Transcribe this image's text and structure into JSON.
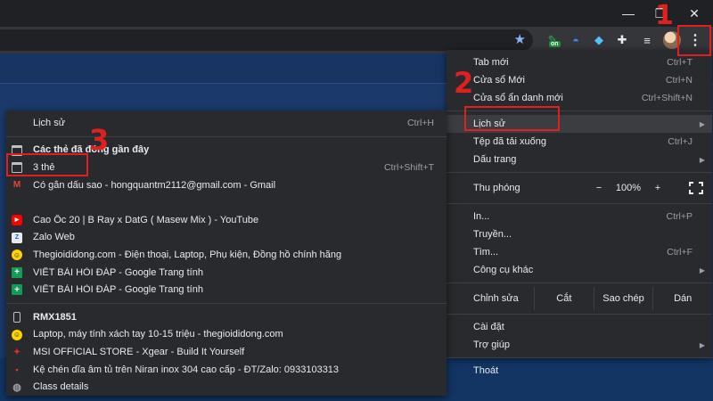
{
  "titlebar": {
    "controls": [
      {
        "name": "minimize-button",
        "glyph": "—"
      },
      {
        "name": "maximize-button",
        "glyph": "❐"
      },
      {
        "name": "close-button",
        "glyph": "✕"
      }
    ]
  },
  "toolbar": {
    "star_glyph": "★",
    "extensions": [
      {
        "name": "extension-on-icon",
        "glyph": "✎",
        "color": "#34a853",
        "badge": "on"
      },
      {
        "name": "extension-planet-icon",
        "glyph": "◓",
        "color": "#4285f4"
      },
      {
        "name": "extension-gem-icon",
        "glyph": "◆",
        "color": "#4fc3f7"
      },
      {
        "name": "extensions-puzzle-icon",
        "glyph": "✚",
        "color": "#e8eaed"
      },
      {
        "name": "reading-list-icon",
        "glyph": "≡",
        "color": "#e8eaed"
      }
    ],
    "menu_glyph": "⋮"
  },
  "menu": {
    "items_top": [
      {
        "label": "Tab mới",
        "shortcut": "Ctrl+T"
      },
      {
        "label": "Cửa sổ Mới",
        "shortcut": "Ctrl+N"
      },
      {
        "label": "Cửa sổ ẩn danh mới",
        "shortcut": "Ctrl+Shift+N"
      }
    ],
    "items_mid": [
      {
        "label": "Lịch sử",
        "shortcut": "",
        "submenu": true,
        "highlighted": true
      },
      {
        "label": "Tệp đã tải xuống",
        "shortcut": "Ctrl+J"
      },
      {
        "label": "Dấu trang",
        "shortcut": "",
        "submenu": true
      }
    ],
    "zoom": {
      "label": "Thu phóng",
      "minus": "−",
      "value": "100%",
      "plus": "+"
    },
    "items_tools": [
      {
        "label": "In...",
        "shortcut": "Ctrl+P"
      },
      {
        "label": "Truyền...",
        "shortcut": ""
      },
      {
        "label": "Tìm...",
        "shortcut": "Ctrl+F"
      },
      {
        "label": "Công cụ khác",
        "shortcut": "",
        "submenu": true
      }
    ],
    "edit": {
      "label": "Chỉnh sửa",
      "cut": "Cắt",
      "copy": "Sao chép",
      "paste": "Dán"
    },
    "items_bottom": [
      {
        "label": "Cài đặt",
        "shortcut": ""
      },
      {
        "label": "Trợ giúp",
        "shortcut": "",
        "submenu": true
      }
    ],
    "exit": {
      "label": "Thoát"
    }
  },
  "history": {
    "header": {
      "label": "Lịch sử",
      "shortcut": "Ctrl+H"
    },
    "recent_title": "Các thẻ đã đóng gần đây",
    "items_recent": [
      {
        "icon": "tab",
        "label": "3 thẻ",
        "shortcut": "Ctrl+Shift+T"
      },
      {
        "icon": "gmail",
        "glyph": "M",
        "label": "Có gắn dấu sao - hongquantm2112@gmail.com - Gmail",
        "shortcut": ""
      }
    ],
    "items_pages": [
      {
        "icon": "yt",
        "glyph": "▶",
        "label": "Cao Ốc 20 | B Ray x DatG ( Masew Mix ) - YouTube"
      },
      {
        "icon": "zalo",
        "glyph": "Z",
        "label": "Zalo Web"
      },
      {
        "icon": "tgdd",
        "glyph": "☺",
        "label": "Thegioididong.com - Điện thoại, Laptop, Phụ kiện, Đồng hồ chính hãng"
      },
      {
        "icon": "sheets",
        "glyph": "+",
        "label": "VIẾT BÀI HỎI ĐÁP - Google Trang tính"
      },
      {
        "icon": "sheets",
        "glyph": "+",
        "label": "VIẾT BÀI HỎI ĐÁP - Google Trang tính"
      }
    ],
    "device_title": "RMX1851",
    "items_device": [
      {
        "icon": "tgdd",
        "glyph": "☺",
        "label": "Laptop, máy tính xách tay 10-15 triệu - thegioididong.com"
      },
      {
        "icon": "msi",
        "glyph": "✦",
        "label": "MSI OFFICIAL STORE - Xgear - Build It Yourself"
      },
      {
        "icon": "niran",
        "glyph": "▪",
        "label": "Kệ chén dĩa âm tủ trên Niran inox 304 cao cấp - ĐT/Zalo: 0933103313"
      },
      {
        "icon": "globe",
        "glyph": "◍",
        "label": "Class details"
      }
    ]
  },
  "annotations": [
    "1",
    "2",
    "3"
  ],
  "colors": {
    "annotation": "#e02020",
    "menu_bg": "#292a2d",
    "page_bg": "#1b3a6b"
  }
}
